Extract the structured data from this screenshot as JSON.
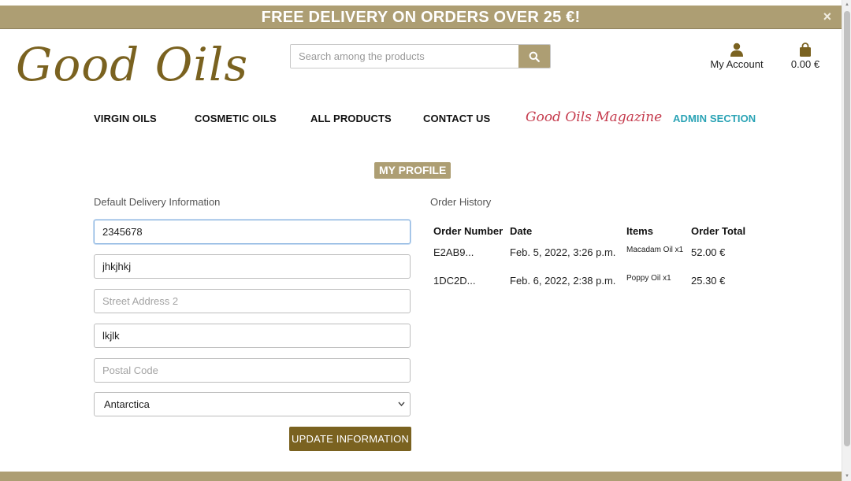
{
  "banner": {
    "text": "FREE DELIVERY ON ORDERS OVER 25 €!",
    "close": "×"
  },
  "header": {
    "logo_text": "Good Oils",
    "search_placeholder": "Search among the products",
    "account_label": "My Account",
    "cart_total": "0.00 €"
  },
  "nav": {
    "items": [
      "VIRGIN OILS",
      "COSMETIC OILS",
      "ALL PRODUCTS",
      "CONTACT US"
    ],
    "magazine": "Good Oils Magazine",
    "admin": "ADMIN SECTION"
  },
  "profile": {
    "title": "MY PROFILE",
    "delivery_label": "Default Delivery Information",
    "fields": {
      "phone": {
        "value": "2345678",
        "placeholder": ""
      },
      "street1": {
        "value": "jhkjhkj",
        "placeholder": ""
      },
      "street2": {
        "value": "",
        "placeholder": "Street Address 2"
      },
      "city": {
        "value": "lkjlk",
        "placeholder": ""
      },
      "postal": {
        "value": "",
        "placeholder": "Postal Code"
      }
    },
    "country": "Antarctica",
    "update_button": "UPDATE INFORMATION"
  },
  "orders": {
    "label": "Order History",
    "headers": [
      "Order Number",
      "Date",
      "Items",
      "Order Total"
    ],
    "rows": [
      {
        "number": "E2AB9...",
        "date": "Feb. 5, 2022, 3:26 p.m.",
        "items": "Macadam Oil x1",
        "total": "52.00 €"
      },
      {
        "number": "1DC2D...",
        "date": "Feb. 6, 2022, 2:38 p.m.",
        "items": "Poppy Oil x1",
        "total": "25.30 €"
      }
    ]
  },
  "colors": {
    "accent": "#ad9e73",
    "dark_gold": "#7a6220",
    "magazine": "#c53b4d",
    "admin": "#2aa3b5"
  },
  "icons": [
    "close-icon",
    "search-icon",
    "user-icon",
    "shopping-bag-icon",
    "chevron-down-icon"
  ]
}
